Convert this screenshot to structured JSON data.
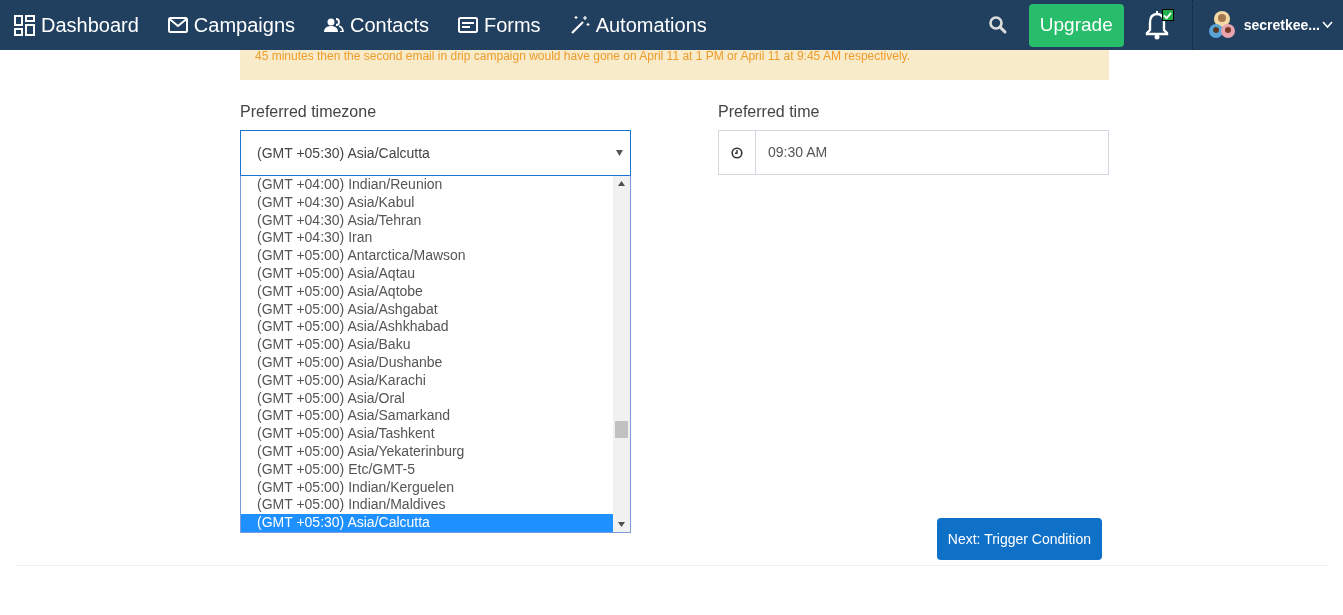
{
  "nav": {
    "items": [
      {
        "kind": "dashboard",
        "label": "Dashboard"
      },
      {
        "kind": "campaigns",
        "label": "Campaigns"
      },
      {
        "kind": "contacts",
        "label": "Contacts"
      },
      {
        "kind": "forms",
        "label": "Forms"
      },
      {
        "kind": "automations",
        "label": "Automations"
      }
    ],
    "upgrade": "Upgrade",
    "notification_badge": true,
    "user": "secretkee..."
  },
  "notice": "45 minutes then the second email in drip campaign would have gone on April 11 at 1 PM or April 11 at 9:45 AM respectively.",
  "timezone": {
    "label": "Preferred timezone",
    "value": "(GMT +05:30) Asia/Calcutta",
    "expanded": true,
    "options": [
      {
        "label": "(GMT +04:00) Indian/Reunion",
        "selected": false
      },
      {
        "label": "(GMT +04:30) Asia/Kabul",
        "selected": false
      },
      {
        "label": "(GMT +04:30) Asia/Tehran",
        "selected": false
      },
      {
        "label": "(GMT +04:30) Iran",
        "selected": false
      },
      {
        "label": "(GMT +05:00) Antarctica/Mawson",
        "selected": false
      },
      {
        "label": "(GMT +05:00) Asia/Aqtau",
        "selected": false
      },
      {
        "label": "(GMT +05:00) Asia/Aqtobe",
        "selected": false
      },
      {
        "label": "(GMT +05:00) Asia/Ashgabat",
        "selected": false
      },
      {
        "label": "(GMT +05:00) Asia/Ashkhabad",
        "selected": false
      },
      {
        "label": "(GMT +05:00) Asia/Baku",
        "selected": false
      },
      {
        "label": "(GMT +05:00) Asia/Dushanbe",
        "selected": false
      },
      {
        "label": "(GMT +05:00) Asia/Karachi",
        "selected": false
      },
      {
        "label": "(GMT +05:00) Asia/Oral",
        "selected": false
      },
      {
        "label": "(GMT +05:00) Asia/Samarkand",
        "selected": false
      },
      {
        "label": "(GMT +05:00) Asia/Tashkent",
        "selected": false
      },
      {
        "label": "(GMT +05:00) Asia/Yekaterinburg",
        "selected": false
      },
      {
        "label": "(GMT +05:00) Etc/GMT-5",
        "selected": false
      },
      {
        "label": "(GMT +05:00) Indian/Kerguelen",
        "selected": false
      },
      {
        "label": "(GMT +05:00) Indian/Maldives",
        "selected": false
      },
      {
        "label": "(GMT +05:30) Asia/Calcutta",
        "selected": true
      }
    ]
  },
  "time": {
    "label": "Preferred time",
    "value": "09:30 AM"
  },
  "next_button": "Next: Trigger Condition"
}
